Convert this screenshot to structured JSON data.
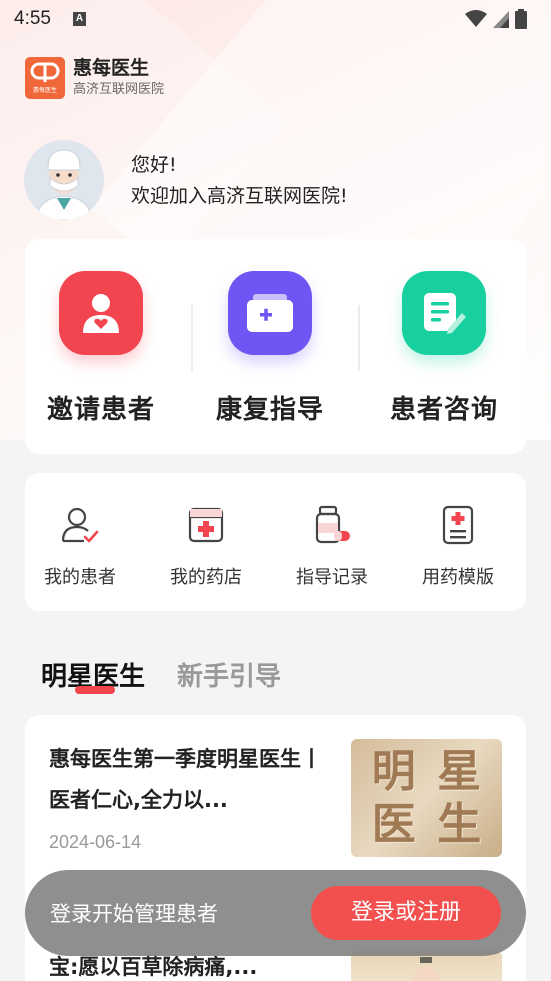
{
  "status_bar": {
    "time": "4:55",
    "notification_icon": "A"
  },
  "brand": {
    "name": "惠每医生",
    "subtitle": "高济互联网医院",
    "logo_sub": "惠每医生"
  },
  "greeting": {
    "line1": "您好!",
    "line2": "欢迎加入高济互联网医院!"
  },
  "quick_actions": [
    {
      "label": "邀请患者",
      "icon": "invite-patient-icon",
      "color": "#f2454f"
    },
    {
      "label": "康复指导",
      "icon": "rehab-folder-icon",
      "color": "#6e55f4"
    },
    {
      "label": "患者咨询",
      "icon": "consult-document-icon",
      "color": "#18cfa0"
    }
  ],
  "tools": [
    {
      "label": "我的患者",
      "icon": "patient-check-icon"
    },
    {
      "label": "我的药店",
      "icon": "pharmacy-store-icon"
    },
    {
      "label": "指导记录",
      "icon": "medicine-bottle-icon"
    },
    {
      "label": "用药模版",
      "icon": "prescription-template-icon"
    }
  ],
  "tabs": {
    "active": "明星医生",
    "inactive": "新手引导"
  },
  "articles": [
    {
      "title": "惠每医生第一季度明星医生丨医者仁心,全力以...",
      "date": "2024-06-14",
      "thumb_text": [
        "明",
        "星",
        "医",
        "生"
      ]
    },
    {
      "title": "宝:愿以百草除病痛,..."
    }
  ],
  "login_bar": {
    "text": "登录开始管理患者",
    "button": "登录或注册"
  },
  "colors": {
    "accent": "#f2504f",
    "brand_orange": "#f0683a"
  }
}
